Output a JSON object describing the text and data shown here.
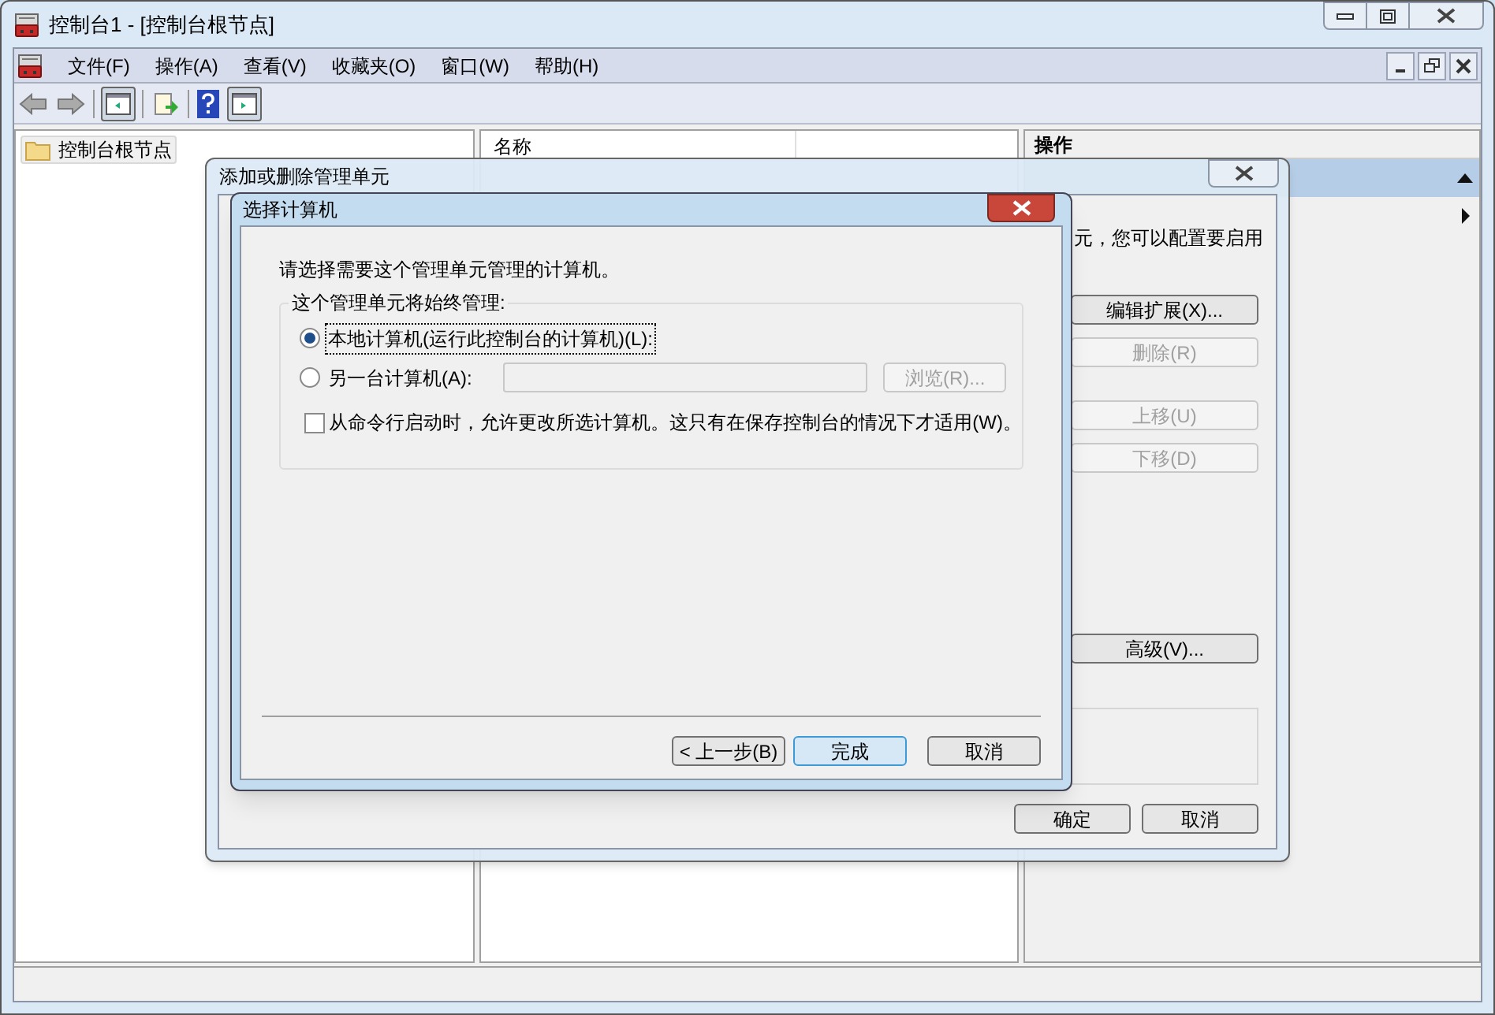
{
  "window": {
    "title": "控制台1 - [控制台根节点]"
  },
  "menu": [
    {
      "label": "文件(F)"
    },
    {
      "label": "操作(A)"
    },
    {
      "label": "查看(V)"
    },
    {
      "label": "收藏夹(O)"
    },
    {
      "label": "窗口(W)"
    },
    {
      "label": "帮助(H)"
    }
  ],
  "tree": {
    "items": [
      {
        "label": "控制台根节点",
        "selected": true
      }
    ]
  },
  "list": {
    "columns": [
      "名称"
    ]
  },
  "actions": {
    "title": "操作"
  },
  "add_remove_dialog": {
    "title": "添加或删除管理单元",
    "text": "元，您可以配置要启用",
    "buttons": [
      {
        "label": "编辑扩展(X)...",
        "disabled": false
      },
      {
        "label": "删除(R)",
        "disabled": true
      },
      {
        "label": "上移(U)",
        "disabled": true
      },
      {
        "label": "下移(D)",
        "disabled": true
      },
      {
        "label": "高级(V)...",
        "disabled": false
      }
    ],
    "footer_buttons": [
      {
        "label": "确定"
      },
      {
        "label": "取消"
      }
    ]
  },
  "select_computer_dialog": {
    "title": "选择计算机",
    "prompt": "请选择需要这个管理单元管理的计算机。",
    "group_label": "这个管理单元将始终管理:",
    "options": [
      {
        "label": "本地计算机(运行此控制台的计算机)(L):",
        "selected": true
      },
      {
        "label": "另一台计算机(A):",
        "selected": false
      }
    ],
    "computer_field": {
      "disabled": true
    },
    "browse_button": {
      "label": "浏览(R)...",
      "disabled": true
    },
    "allow_change": {
      "label": "从命令行启动时，允许更改所选计算机。这只有在保存控制台的情况下才适用(W)。",
      "checked": false
    },
    "buttons": [
      {
        "label": "< 上一步(B)",
        "default": false
      },
      {
        "label": "完成",
        "default": true
      },
      {
        "label": "取消",
        "default": false
      }
    ]
  }
}
